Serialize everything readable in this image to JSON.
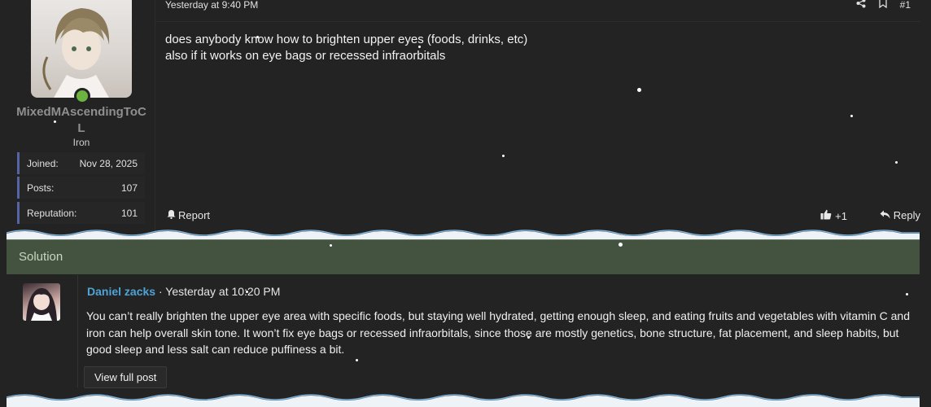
{
  "post": {
    "user": {
      "username": "MixedMAscendingToCL",
      "rank": "Iron",
      "stats": [
        {
          "label": "Joined:",
          "value": "Nov 28, 2025"
        },
        {
          "label": "Posts:",
          "value": "107"
        },
        {
          "label": "Reputation:",
          "value": "101"
        }
      ]
    },
    "date": "Yesterday at 9:40 PM",
    "number": "#1",
    "body_lines": [
      "does anybody know how to brighten upper eyes (foods, drinks, etc)",
      "also if it works on eye bags or recessed infraorbitals"
    ],
    "report_label": "Report",
    "reaction_count": "+1",
    "reply_label": "Reply",
    "icons": [
      "share-icon",
      "bookmark-icon",
      "bell-icon",
      "thumbs-up-icon",
      "reply-arrow-icon"
    ]
  },
  "solution": {
    "heading": "Solution",
    "author": "Daniel zacks",
    "separator": " · ",
    "date": "Yesterday at 10:20 PM",
    "text": "You can’t really brighten the upper eye area with specific foods, but staying well hydrated, getting enough sleep, and eating fruits and vegetables with vitamin C and iron can help overall skin tone. It won’t fix eye bags or recessed infraorbitals, since those are mostly genetics, bone structure, fat placement, and sleep habits, but good sleep and less salt can reduce puffiness a bit.",
    "view_full_label": "View full post"
  },
  "colors": {
    "background": "#232323",
    "solution_bar": "#445240",
    "stat_accent": "#5663a5",
    "author_link": "#4fa3d6",
    "online": "#6cb33f"
  }
}
